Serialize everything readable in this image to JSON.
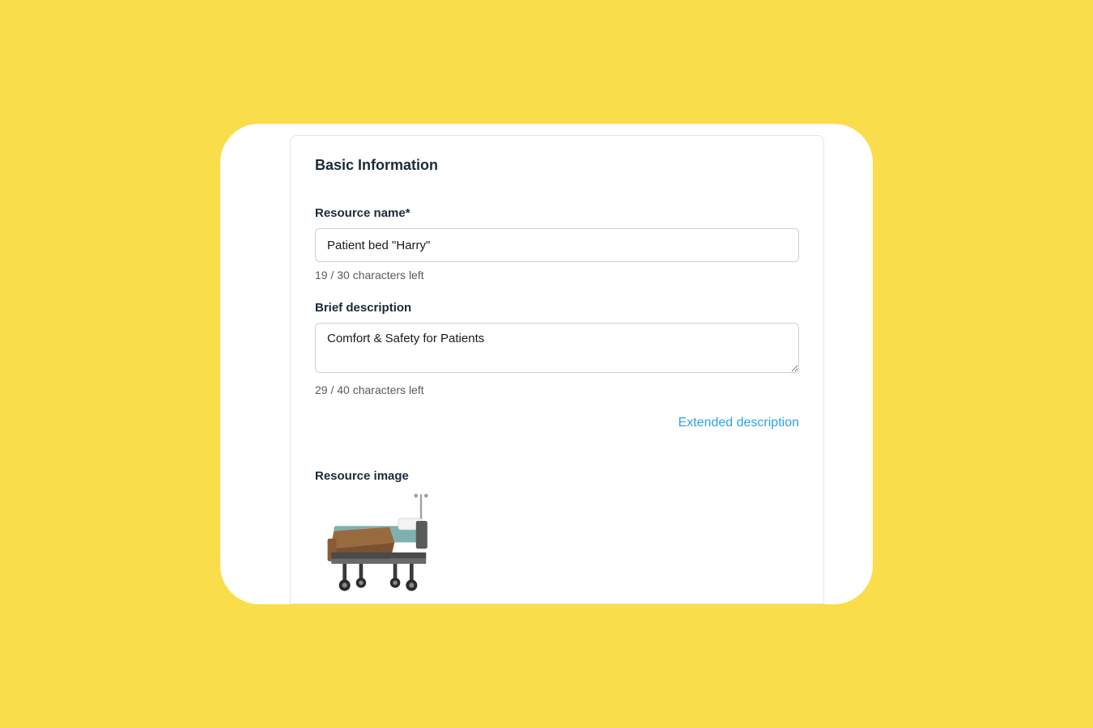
{
  "section": {
    "title": "Basic Information"
  },
  "resource_name": {
    "label": "Resource name*",
    "value": "Patient bed \"Harry\"",
    "helper": "19 / 30 characters left"
  },
  "brief_description": {
    "label": "Brief description",
    "value": "Comfort & Safety for Patients",
    "helper": "29 / 40 characters left"
  },
  "extended_description": {
    "link_label": "Extended description"
  },
  "resource_image": {
    "label": "Resource image",
    "alt": "hospital-bed"
  }
}
